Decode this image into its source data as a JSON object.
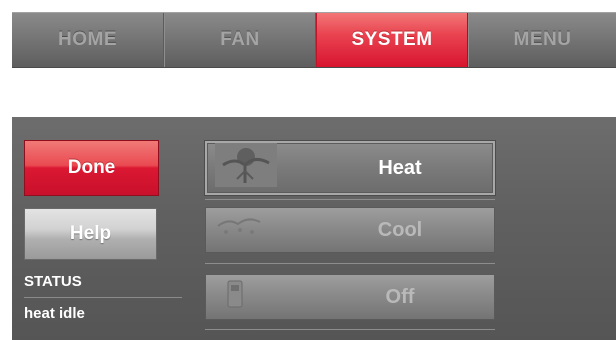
{
  "tabs": [
    {
      "label": "HOME",
      "active": false
    },
    {
      "label": "FAN",
      "active": false
    },
    {
      "label": "SYSTEM",
      "active": true
    },
    {
      "label": "MENU",
      "active": false
    }
  ],
  "actions": {
    "done_label": "Done",
    "help_label": "Help"
  },
  "status": {
    "label": "STATUS",
    "value": "heat idle"
  },
  "modes": [
    {
      "label": "Heat",
      "selected": true,
      "icon": "heat-icon"
    },
    {
      "label": "Cool",
      "selected": false,
      "icon": "cool-icon"
    },
    {
      "label": "Off",
      "selected": false,
      "icon": "off-icon"
    }
  ],
  "colors": {
    "accent_red": "#d8142f",
    "panel_gray": "#616161",
    "inactive_text": "#a4a4a4"
  }
}
